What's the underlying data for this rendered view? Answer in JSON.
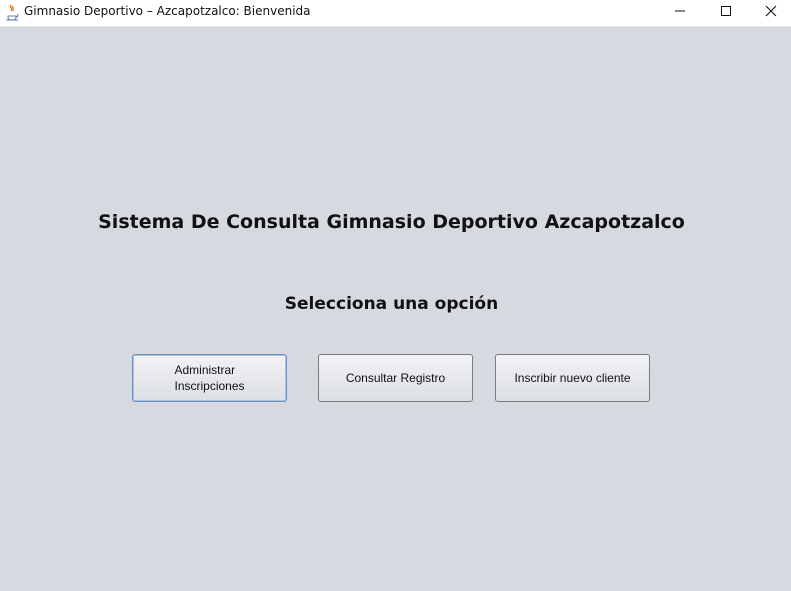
{
  "window": {
    "title": "Gimnasio Deportivo – Azcapotzalco: Bienvenida",
    "icon": "java-cup-icon",
    "controls": {
      "minimize_icon": "minimize-icon",
      "maximize_icon": "maximize-icon",
      "close_icon": "close-icon"
    }
  },
  "main": {
    "title": "Sistema De Consulta Gimnasio Deportivo Azcapotzalco",
    "subtitle": "Selecciona una opción",
    "buttons": {
      "admin": {
        "line1": "Administrar",
        "line2": "Inscripciones",
        "focused": true
      },
      "consult": {
        "label": "Consultar Registro"
      },
      "new_client": {
        "label": "Inscribir nuevo cliente"
      }
    }
  },
  "colors": {
    "background": "#d6d9e0",
    "titlebar": "#ffffff",
    "focus_border": "#6f8fb8"
  }
}
